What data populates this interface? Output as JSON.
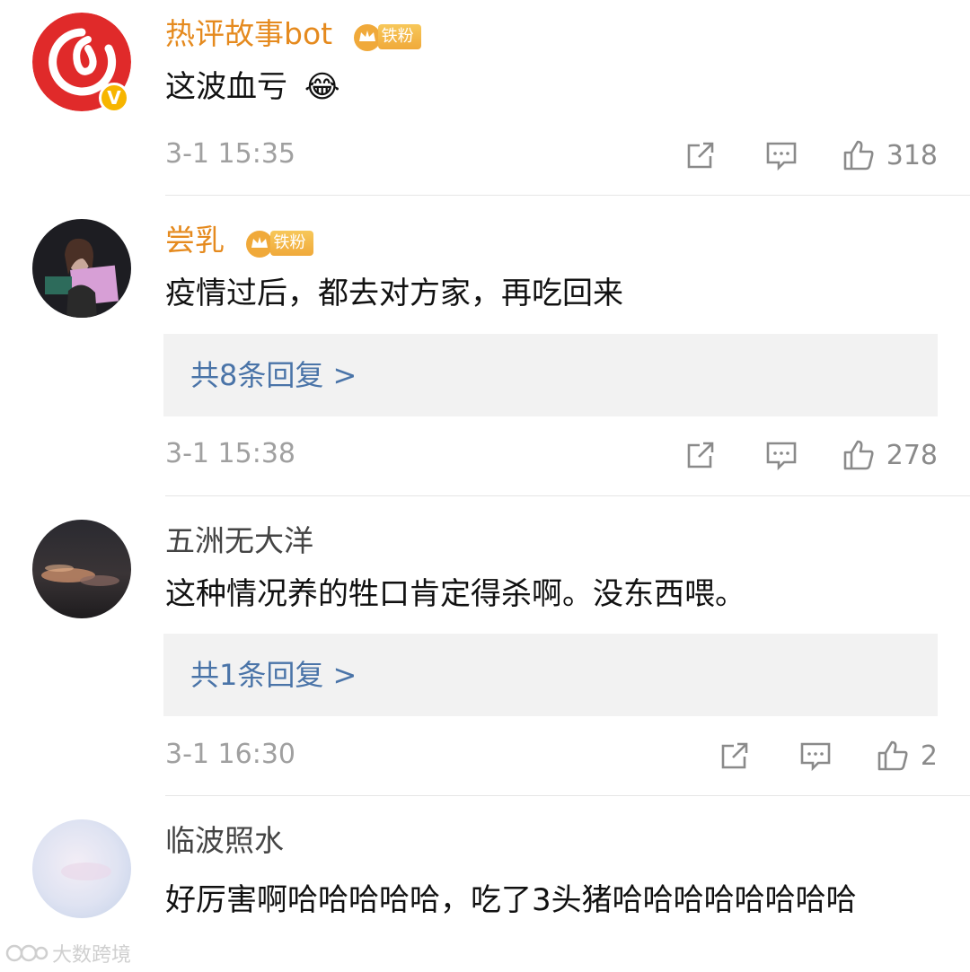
{
  "comments": [
    {
      "username": "热评故事bot",
      "fan_badge": "铁粉",
      "text": "这波血亏",
      "emoji": "😂",
      "time": "3-1 15:35",
      "likes": "318"
    },
    {
      "username": "尝乳",
      "fan_badge": "铁粉",
      "text": "疫情过后，都去对方家，再吃回来",
      "replies": "共8条回复 >",
      "time": "3-1 15:38",
      "likes": "278"
    },
    {
      "username": "五洲无大洋",
      "text": "这种情况养的牲口肯定得杀啊。没东西喂。",
      "replies": "共1条回复 >",
      "time": "3-1 16:30",
      "likes": "2"
    },
    {
      "username": "临波照水",
      "text": "好厉害啊哈哈哈哈哈，吃了3头猪哈哈哈哈哈哈哈哈"
    }
  ],
  "watermark": "大数跨境",
  "colors": {
    "vip_name": "#e58a1e",
    "reply_link": "#4a74a8",
    "reply_bg": "#f2f2f2",
    "meta": "#a0a0a0"
  },
  "icons": [
    "forward-icon",
    "comment-icon",
    "like-icon",
    "verified-icon",
    "fan-crown-icon"
  ]
}
